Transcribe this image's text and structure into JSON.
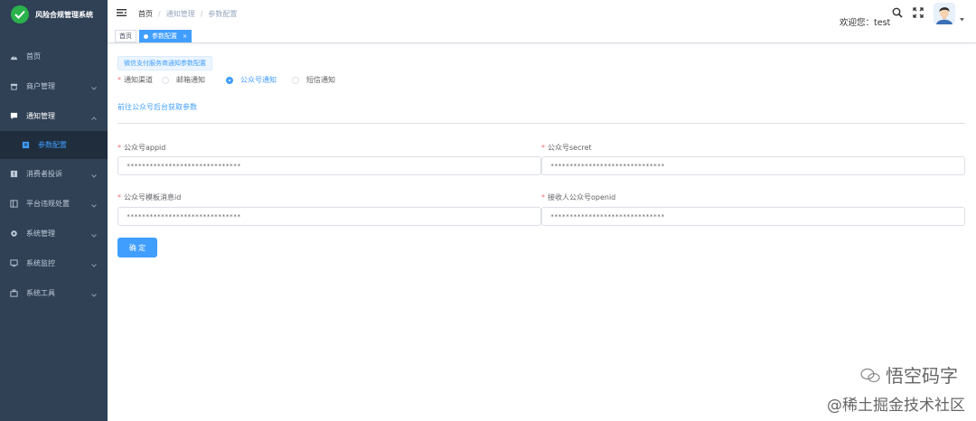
{
  "app": {
    "title": "风险合规管理系统",
    "brand_color": "#2bb24c"
  },
  "sidebar": {
    "items": [
      {
        "label": "首页",
        "icon": "dashboard-icon",
        "has_arrow": false
      },
      {
        "label": "商户管理",
        "icon": "store-icon",
        "has_arrow": true
      },
      {
        "label": "通知管理",
        "icon": "message-icon",
        "has_arrow": true,
        "expanded": true
      },
      {
        "label": "消费者投诉",
        "icon": "complaint-icon",
        "has_arrow": true
      },
      {
        "label": "平台违规处置",
        "icon": "violation-icon",
        "has_arrow": true
      },
      {
        "label": "系统管理",
        "icon": "gear-icon",
        "has_arrow": true
      },
      {
        "label": "系统监控",
        "icon": "monitor-icon",
        "has_arrow": true
      },
      {
        "label": "系统工具",
        "icon": "toolbox-icon",
        "has_arrow": true
      }
    ],
    "active_sub": {
      "label": "参数配置",
      "icon": "document-icon"
    }
  },
  "header": {
    "breadcrumb": [
      "首页",
      "通知管理",
      "参数配置"
    ],
    "welcome": "欢迎您：test"
  },
  "tags": {
    "home": "首页",
    "active": "参数配置",
    "close": "×"
  },
  "form": {
    "tip_button": "微信支付服务商通知参数配置",
    "channel": {
      "label": "通知渠道",
      "options": [
        "邮箱通知",
        "公众号通知",
        "短信通知"
      ],
      "selected": "公众号通知"
    },
    "link": "前往公众号后台获取参数",
    "fields": {
      "appid": {
        "label": "公众号appid",
        "value": "******************************"
      },
      "secret": {
        "label": "公众号secret",
        "value": "******************************"
      },
      "template_id": {
        "label": "公众号模板消息id",
        "value": "******************************"
      },
      "openid": {
        "label": "接收人公众号openid",
        "value": "******************************"
      }
    },
    "required_mark": "*",
    "submit": "确 定"
  },
  "watermark": {
    "line1": "悟空码字",
    "line2": "@稀土掘金技术社区"
  },
  "colors": {
    "sidebar_bg": "#304156",
    "primary": "#409eff",
    "required": "#f56c6c"
  }
}
